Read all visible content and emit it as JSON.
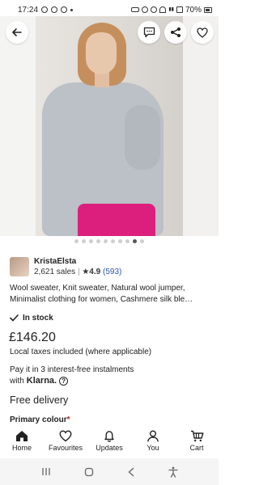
{
  "status": {
    "time": "17:24",
    "battery": "70%"
  },
  "pagination": {
    "count": 10,
    "active_index": 8
  },
  "seller": {
    "name": "KristaElsta",
    "sales": "2,621 sales",
    "rating": "4.9",
    "review_count": "(593)"
  },
  "product": {
    "title": "Wool sweater, Knit sweater, Natural wool jumper, Minimalist clothing for women, Cashmere silk ble…",
    "stock": "In stock",
    "price": "£146.20",
    "tax_note": "Local taxes included (where applicable)",
    "klarna_line1": "Pay it in 3 interest-free instalments",
    "klarna_with": "with",
    "klarna_brand": "Klarna.",
    "delivery": "Free delivery",
    "primary_colour_label": "Primary colour",
    "required_mark": "*"
  },
  "nav": {
    "home": "Home",
    "favourites": "Favourites",
    "updates": "Updates",
    "you": "You",
    "cart": "Cart"
  },
  "colors": {
    "accent_link": "#2a55a8",
    "required": "#c91a1a"
  }
}
